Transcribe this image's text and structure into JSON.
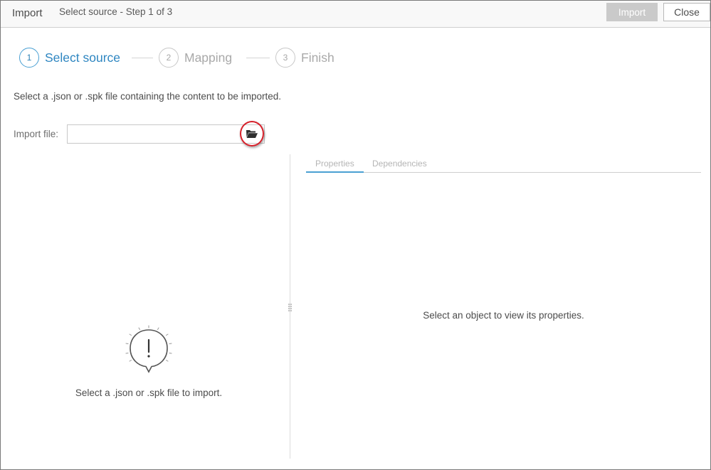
{
  "header": {
    "title": "Import",
    "subtitle": "Select source - Step 1 of 3",
    "import_label": "Import",
    "close_label": "Close"
  },
  "stepper": {
    "steps": [
      {
        "number": "1",
        "label": "Select source",
        "state": "active"
      },
      {
        "number": "2",
        "label": "Mapping",
        "state": "inactive"
      },
      {
        "number": "3",
        "label": "Finish",
        "state": "inactive"
      }
    ]
  },
  "instruction": "Select a .json or .spk file containing the content to be imported.",
  "import_file": {
    "label": "Import file:",
    "value": "",
    "browse_icon": "folder-open-icon"
  },
  "left_pane": {
    "empty_icon": "exclamation-bubble-icon",
    "empty_message": "Select a .json or .spk file to import."
  },
  "right_pane": {
    "tabs": [
      {
        "label": "Properties",
        "active": true
      },
      {
        "label": "Dependencies",
        "active": false
      }
    ],
    "empty_message": "Select an object to view its properties."
  },
  "colors": {
    "accent": "#2e86c1",
    "highlight": "#d6202a",
    "disabled_button": "#cacaca"
  }
}
